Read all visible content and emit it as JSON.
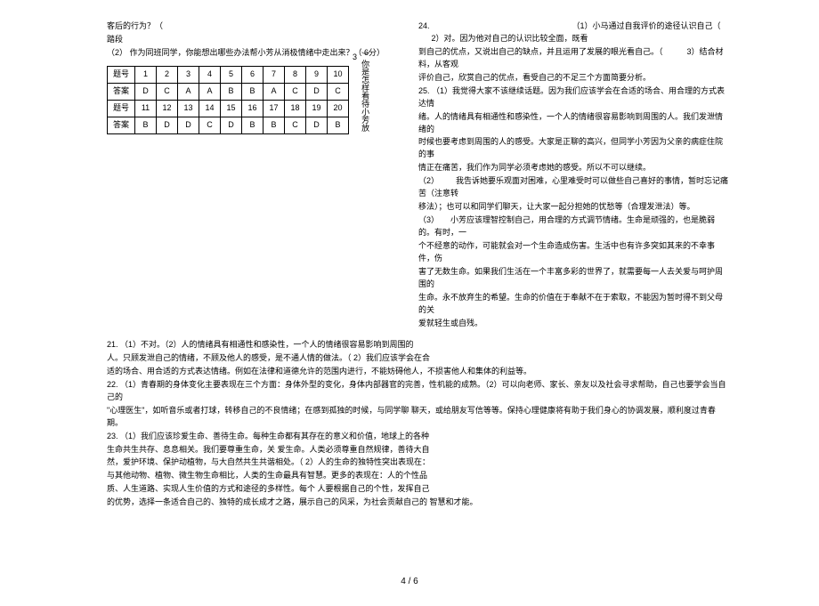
{
  "header": {
    "fragment_top": "客后的行为？（",
    "fragment_under": "踏段",
    "q2_label": "（2）",
    "q2_text": "作为同班同学，你能想出哪些办法帮小芳从消极情绪中走出来？（   6分）",
    "q3_label": "3",
    "q3_text": "）你是怎样看待小芳放"
  },
  "table": {
    "row_label": "题号",
    "ans_label": "答案",
    "r1": [
      "1",
      "2",
      "3",
      "4",
      "5",
      "6",
      "7",
      "8",
      "9",
      "10"
    ],
    "a1": [
      "D",
      "C",
      "A",
      "A",
      "B",
      "B",
      "A",
      "C",
      "D",
      "C"
    ],
    "r2": [
      "11",
      "12",
      "13",
      "14",
      "15",
      "16",
      "17",
      "18",
      "19",
      "20"
    ],
    "a2": [
      "B",
      "D",
      "D",
      "C",
      "D",
      "B",
      "B",
      "C",
      "D",
      "B"
    ]
  },
  "right": {
    "q24_num": "24.",
    "q24_1": "（1）小马通过自我评价的途径认识自己（",
    "q24_2": "2）对。因为他对自己的认识比较全面，既看",
    "q24_line2": "到自己的优点，又说出自己的缺点，并且运用了发展的眼光看自己。（",
    "q24_3": "3）结合材料，从客观",
    "q24_line3": "评价自己，欣赏自己的优点，看受自己的不足三个方面简要分析。",
    "q25_num": "25.",
    "q25_1": "（1）我觉得大家不该继续话题。因为我们应该学会在合适的场合、用合理的方式表达情",
    "q25_l2": "绪。人的情绪具有相通性和感染性，一个人的情绪很容易影响到周围的人。我们发泄情绪的",
    "q25_l3": "时候也要考虑到周围的人的感受。大家是正聊的高兴，但同学小芳因为父亲的病症住院的事",
    "q25_l4": "情正在痛苦，我们作为同学必须考虑她的感受。所以不可以继续。",
    "q25_2a": "（2）",
    "q25_2b": "我告诉她要乐观面对困难，心里难受时可以做些自己喜好的事情，暂时忘记痛苦（注意转",
    "q25_l6": "移法）；也可以和同学们聊天，让大家一起分担她的忧愁等（合理发泄法）等。",
    "q25_3a": "（3）",
    "q25_3b": "小芳应该理智控制自己，用合理的方式调节情绪。生命是顽强的，也是脆弱的。有时，一",
    "q25_l8": "个不经意的动作，可能就会对一个生命造成伤害。生活中也有许多突如其来的不幸事件，伤",
    "q25_l9": "害了无数生命。如果我们生活在一个丰富多彩的世界了，就需要每一人去关爱与呵护周围的",
    "q25_l10": "生命。永不放弃生的希望。生命的价值在于奉献不在于索取，不能因为暂时得不到父母的关",
    "q25_l11": "爱就轻生或自残。"
  },
  "lower": {
    "q21a": "21. （1）不对。（2）人的情绪具有相通性和感染性，一个人的情绪很容易影响到周围的",
    "q21b": "人。只顾发泄自己的情绪，不顾及他人的感受，是不通人情的做法。（     2）我们应该学会在合",
    "q21c": "适的场合、用合适的方式表达情绪。例如在法律和道德允许的范围内进行，不能妨碍他人，不损害他人和集体的利益等。",
    "q22a": "22. （1）青春期的身体变化主要表现在三个方面：身体外型的变化，身体内部器官的完善，性机能的成熟。（2）可以向老师、家长、亲友以及社会寻求帮助，自己也要学会当自己的",
    "q22b": "    \"心理医生\"，如听音乐或者打球，转移自己的不良情绪；在感到孤独的时候，与同学聊 聊天，或给朋友写信等等。保持心理健康将有助于我们身心的协调发展，顺利度过青春期。",
    "q23a": "23. （1）我们应该珍爱生命、善待生命。每种生命都有其存在的意义和价值，地球上的各种",
    "q23b": "生命共生共存、息息相关。我们要尊重生命，关     爱生命。人类必须尊重自然规律，善待大自",
    "q23c": "然，爱护环境、保护动植物，与大自然共生共谐相处。（     2）人的生命的独特性突出表现在：",
    "q23d": "与其他动物、植物、微生物生命相比，人类的生命最具有智慧。更多的表现在：人的个性品",
    "q23e": "质、人生道路、实现人生价值的方式和途径的多样性。每个     人要根据自己的个性，发挥自己",
    "q23f": "的优势，选择一条适合自己的、独特的成长成才之路，展示自己的风采，为社会贡献自己的 智慧和才能。"
  },
  "footer": {
    "page": "4 / 6"
  }
}
